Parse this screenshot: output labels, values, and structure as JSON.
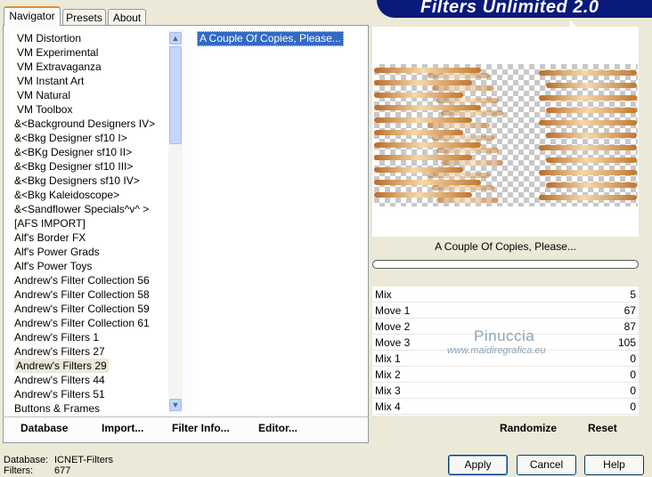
{
  "tabs": [
    "Navigator",
    "Presets",
    "About"
  ],
  "banner_title": "Filters Unlimited 2.0",
  "filters": [
    "VM Distortion",
    "VM Experimental",
    "VM Extravaganza",
    "VM Instant Art",
    "VM Natural",
    "VM Toolbox",
    "&<Background Designers IV>",
    "&<Bkg Designer sf10 I>",
    "&<BKg Designer sf10 II>",
    "&<Bkg Designer sf10 III>",
    "&<Bkg Designers sf10 IV>",
    "&<Bkg Kaleidoscope>",
    "&<Sandflower Specials^v^ >",
    "[AFS IMPORT]",
    "Alf's Border FX",
    "Alf's Power Grads",
    "Alf's Power Toys",
    "Andrew's Filter Collection 56",
    "Andrew's Filter Collection 58",
    "Andrew's Filter Collection 59",
    "Andrew's Filter Collection 61",
    "Andrew's Filters 1",
    "Andrew's Filters 27",
    "Andrew's Filters 29",
    "Andrew's Filters 44",
    "Andrew's Filters 51",
    "Buttons & Frames"
  ],
  "selected_filter_index": 23,
  "effects": [
    "A Couple Of Copies, Please..."
  ],
  "left_buttons": {
    "database": "Database",
    "import": "Import...",
    "filter_info": "Filter Info...",
    "editor": "Editor..."
  },
  "preview_title": "A Couple Of Copies, Please...",
  "params": [
    {
      "label": "Mix",
      "value": "5"
    },
    {
      "label": "Move 1",
      "value": "67"
    },
    {
      "label": "Move 2",
      "value": "87"
    },
    {
      "label": "Move 3",
      "value": "105"
    },
    {
      "label": "Mix 1",
      "value": "0"
    },
    {
      "label": "Mix 2",
      "value": "0"
    },
    {
      "label": "Mix 3",
      "value": "0"
    },
    {
      "label": "Mix 4",
      "value": "0"
    }
  ],
  "watermark": {
    "name": "Pinuccia",
    "site": "www.maidiregrafica.eu"
  },
  "right_buttons": {
    "randomize": "Randomize",
    "reset": "Reset"
  },
  "info": {
    "db_label": "Database:",
    "db_value": "ICNET-Filters",
    "filters_label": "Filters:",
    "filters_value": "677"
  },
  "dialog_buttons": {
    "apply": "Apply",
    "cancel": "Cancel",
    "help": "Help"
  },
  "colors": {
    "banner": "#0a1a7a",
    "selection": "#316ac5",
    "tab_accent": "#e68b2c"
  },
  "icons": {
    "scroll_up": "chevron-up-icon",
    "scroll_down": "chevron-down-icon"
  }
}
